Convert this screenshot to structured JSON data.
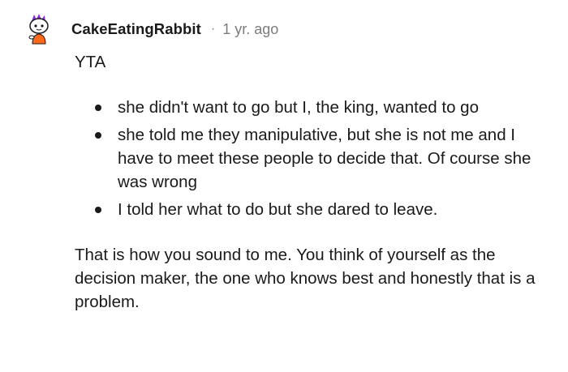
{
  "comment": {
    "username": "CakeEatingRabbit",
    "separator": "·",
    "timestamp": "1 yr. ago",
    "verdict": "YTA",
    "bullets": [
      "she didn't want to go but I, the king, wanted to go",
      "she told me they manipulative, but she is not me and I have to meet these people to decide that. Of course she was wrong",
      "I told her what to do but she dared to leave."
    ],
    "closing": "That is how you sound to me. You think of yourself as the decision maker, the one who knows best and honestly that is a problem.",
    "avatar_icon": "snoo-avatar-icon",
    "colors": {
      "text": "#1a1a1b",
      "meta": "#7c7c7c",
      "avatar_hair": "#8a2be2",
      "avatar_shirt": "#ff6a1a"
    }
  }
}
